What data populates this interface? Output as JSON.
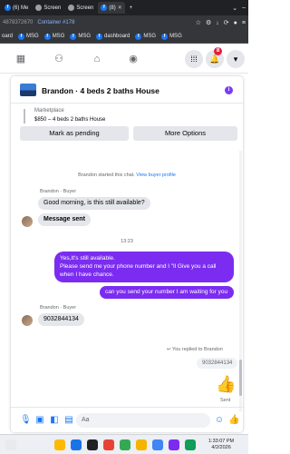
{
  "browser": {
    "tabs": [
      {
        "label": "(6) Me",
        "icon": "facebook-icon"
      },
      {
        "label": "Screen",
        "icon": "screen-icon"
      },
      {
        "label": "Screen",
        "icon": "screen-icon"
      },
      {
        "label": "(8)",
        "icon": "facebook-icon"
      }
    ],
    "url_fragment": "4878372670",
    "container_label": "Container #178",
    "bookmarks": [
      "oard",
      "MSG",
      "MSG",
      "MSG",
      "dashboard",
      "MSG",
      "MSG"
    ]
  },
  "fb_nav": {
    "notification_count": "8"
  },
  "chat": {
    "title": "Brandon · 4 beds 2 baths House",
    "marketplace_label": "Marketplace",
    "listing_price": "$850 – 4 beds 2 baths House",
    "mark_pending_label": "Mark as pending",
    "more_options_label": "More Options",
    "started_text": "Brandon started this chat.",
    "view_profile_link": "View buyer profile",
    "buyer_label_1": "Brandon · Buyer",
    "msg_in_1": "Good morning, is this still available?",
    "msg_in_2": "Message sent",
    "timestamp": "13:23",
    "msg_out_1_line1": "Yes,It's still available.",
    "msg_out_1_line2": "Please send me your phone number and I \"ll Give you a call",
    "msg_out_1_line3": "when I have chance.",
    "msg_out_2": "can you send your number I am waiting for you",
    "buyer_label_2": "Brandon · Buyer",
    "msg_in_3": "9032844134",
    "replied_label": "You replied to Brandon",
    "quoted_text": "9032844134",
    "sent_status": "Sent",
    "composer_placeholder": "Aa"
  },
  "taskbar": {
    "time": "1:33:07 PM",
    "date": "4/2/2026"
  },
  "colors": {
    "messenger_purple": "#7b2cf0",
    "fb_blue": "#1877f2",
    "bubble_gray": "#e4e6eb"
  }
}
